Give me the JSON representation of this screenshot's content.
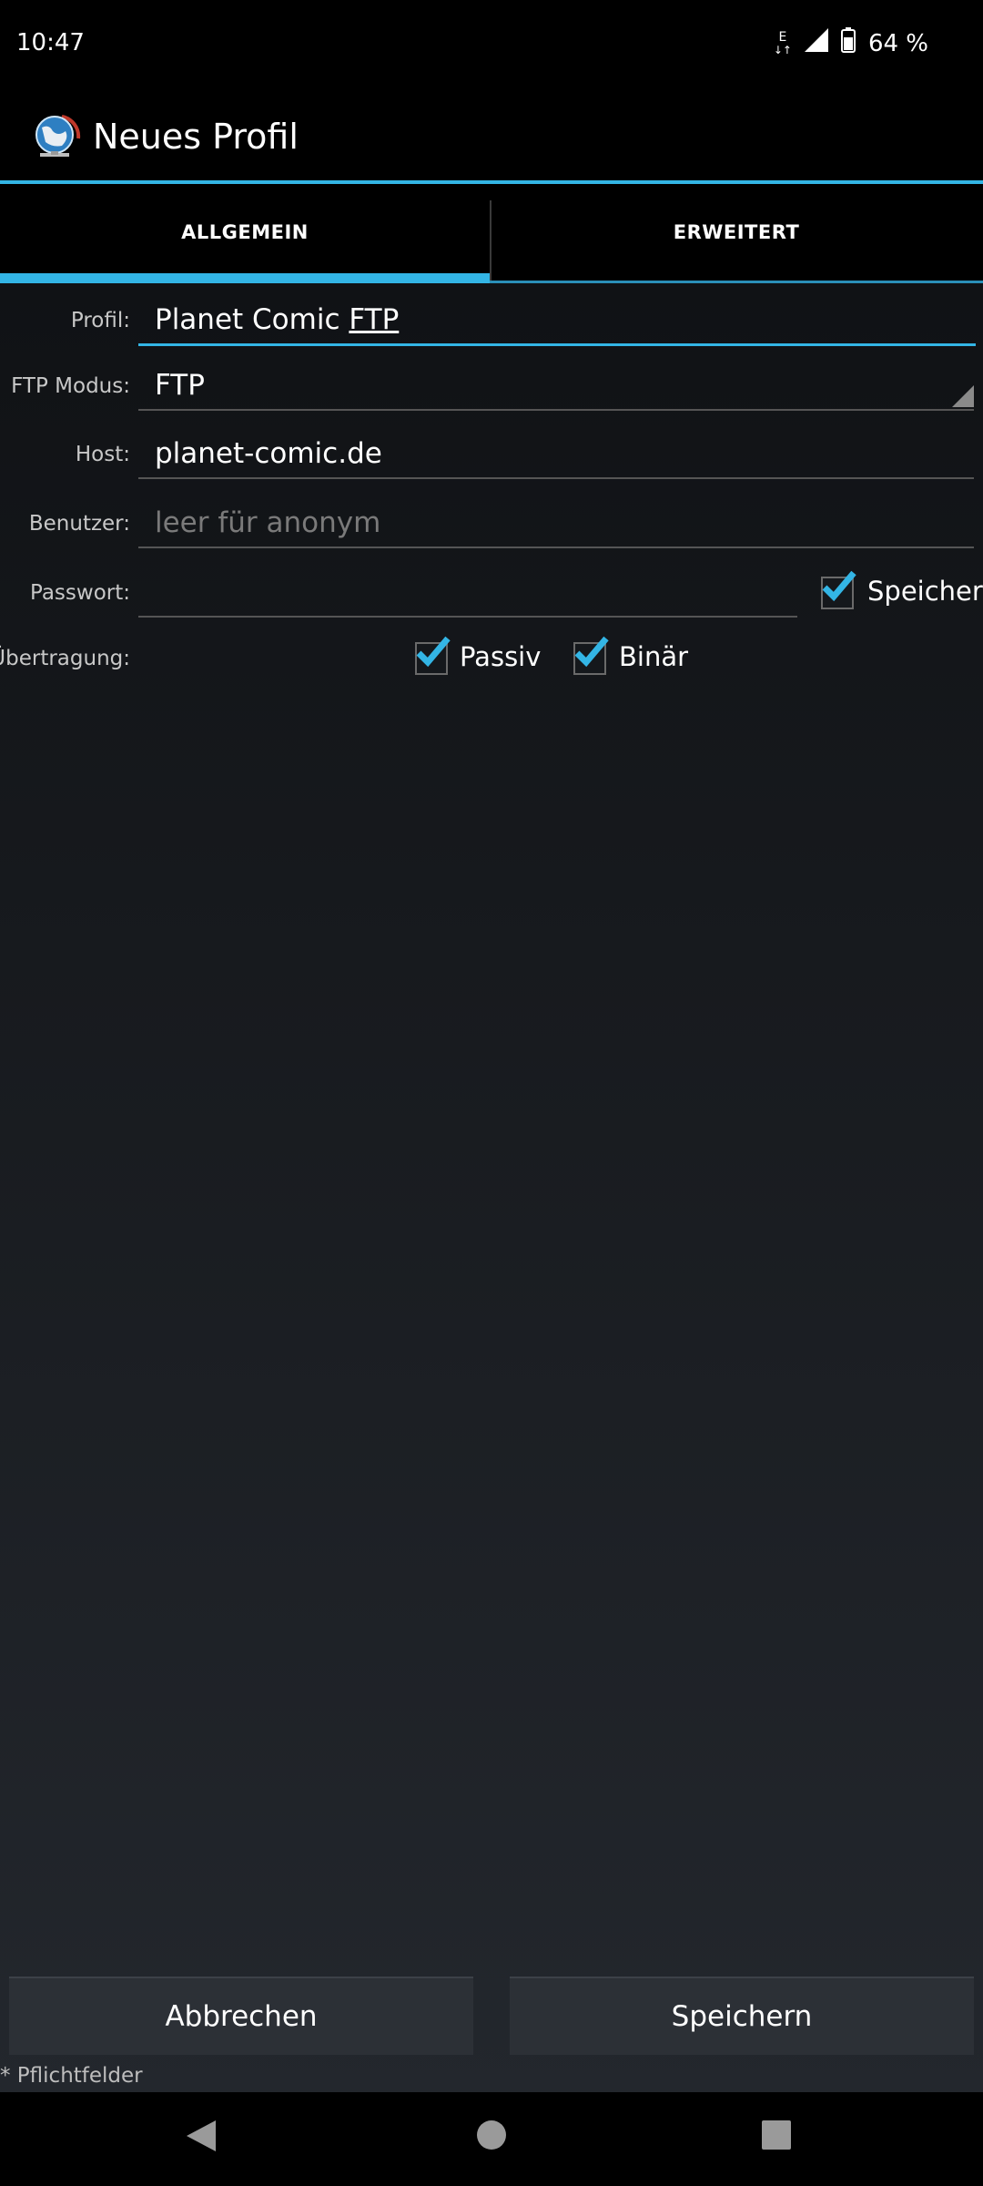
{
  "status": {
    "time": "10:47",
    "network": "E",
    "battery": "64 %"
  },
  "appbar": {
    "title": "Neues Profil"
  },
  "tabs": [
    {
      "label": "ALLGEMEIN",
      "selected": true
    },
    {
      "label": "ERWEITERT",
      "selected": false
    }
  ],
  "form": {
    "profil_label": "Profil:",
    "profil_value_plain": "Planet Comic ",
    "profil_value_underlined": "FTP",
    "modus_label": "FTP Modus:",
    "modus_value": "FTP",
    "host_label": "Host:",
    "host_value": "planet-comic.de",
    "benutzer_label": "Benutzer:",
    "benutzer_placeholder": "leer für anonym",
    "passwort_label": "Passwort:",
    "passwort_value": "",
    "speichern_label": "Speichern",
    "speichern_checked": true,
    "uebertragung_label": "Übertragung:",
    "passiv_label": "Passiv",
    "passiv_checked": true,
    "binaer_label": "Binär",
    "binaer_checked": true
  },
  "buttons": {
    "cancel": "Abbrechen",
    "save": "Speichern"
  },
  "footer": {
    "required_note": "* Pflichtfelder"
  },
  "colors": {
    "accent": "#33b5e5",
    "background_top": "#101215",
    "background_bottom": "#23272d"
  }
}
